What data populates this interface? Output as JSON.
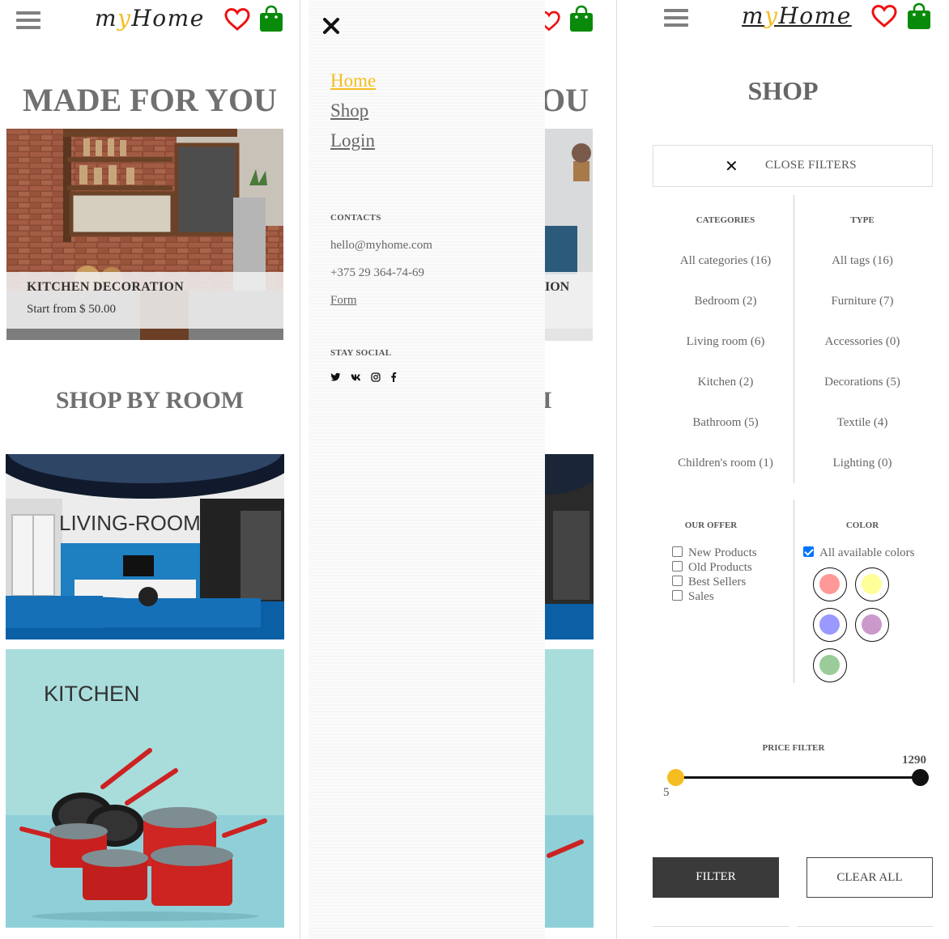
{
  "header": {
    "logo_prefix": "m",
    "logo_y": "y",
    "logo_suffix": "Home",
    "icons": [
      "menu-icon",
      "heart-icon",
      "shopping-bag-icon"
    ]
  },
  "home": {
    "made_for_you": "MADE FOR YOU",
    "deco_title": "KITCHEN DECORATION",
    "deco_price": "Start from $ 50.00",
    "shop_by_room": "SHOP BY ROOM",
    "rooms": [
      "LIVING-ROOM",
      "KITCHEN"
    ]
  },
  "menu": {
    "close_icon": "close-icon",
    "links": [
      "Home",
      "Shop",
      "Login"
    ],
    "contacts_title": "CONTACTS",
    "email": "hello@myhome.com",
    "phone": "+375 29 364-74-69",
    "form_link": "Form",
    "social_title": "STAY SOCIAL",
    "social_icons": [
      "twitter-icon",
      "vk-icon",
      "instagram-icon",
      "facebook-icon"
    ],
    "behind": {
      "made_for_you_tail": "OU",
      "deco_tail": "ION",
      "shop_by_room_tail": "I"
    }
  },
  "shop": {
    "title": "SHOP",
    "close_filters": "CLOSE FILTERS",
    "categories_title": "CATEGORIES",
    "categories": [
      "All categories (16)",
      "Bedroom (2)",
      "Living room (6)",
      "Kitchen (2)",
      "Bathroom (5)",
      "Children's room (1)"
    ],
    "type_title": "TYPE",
    "types": [
      "All tags (16)",
      "Furniture (7)",
      "Accessories (0)",
      "Decorations (5)",
      "Textile (4)",
      "Lighting (0)"
    ],
    "offer_title": "OUR OFFER",
    "offers": [
      "New Products",
      "Old Products",
      "Best Sellers",
      "Sales"
    ],
    "offers_checked": [
      false,
      false,
      false,
      false
    ],
    "color_title": "COLOR",
    "all_colors_label": "All available colors",
    "all_colors_checked": true,
    "swatches": [
      "#ff9999",
      "#ffff99",
      "#9999ff",
      "#cc99cc",
      "#99cc99"
    ],
    "price_title": "PRICE FILTER",
    "price_min": "5",
    "price_max": "1290",
    "filter_button": "FILTER",
    "clear_button": "CLEAR ALL",
    "accent_color": "#f5bd1f"
  }
}
